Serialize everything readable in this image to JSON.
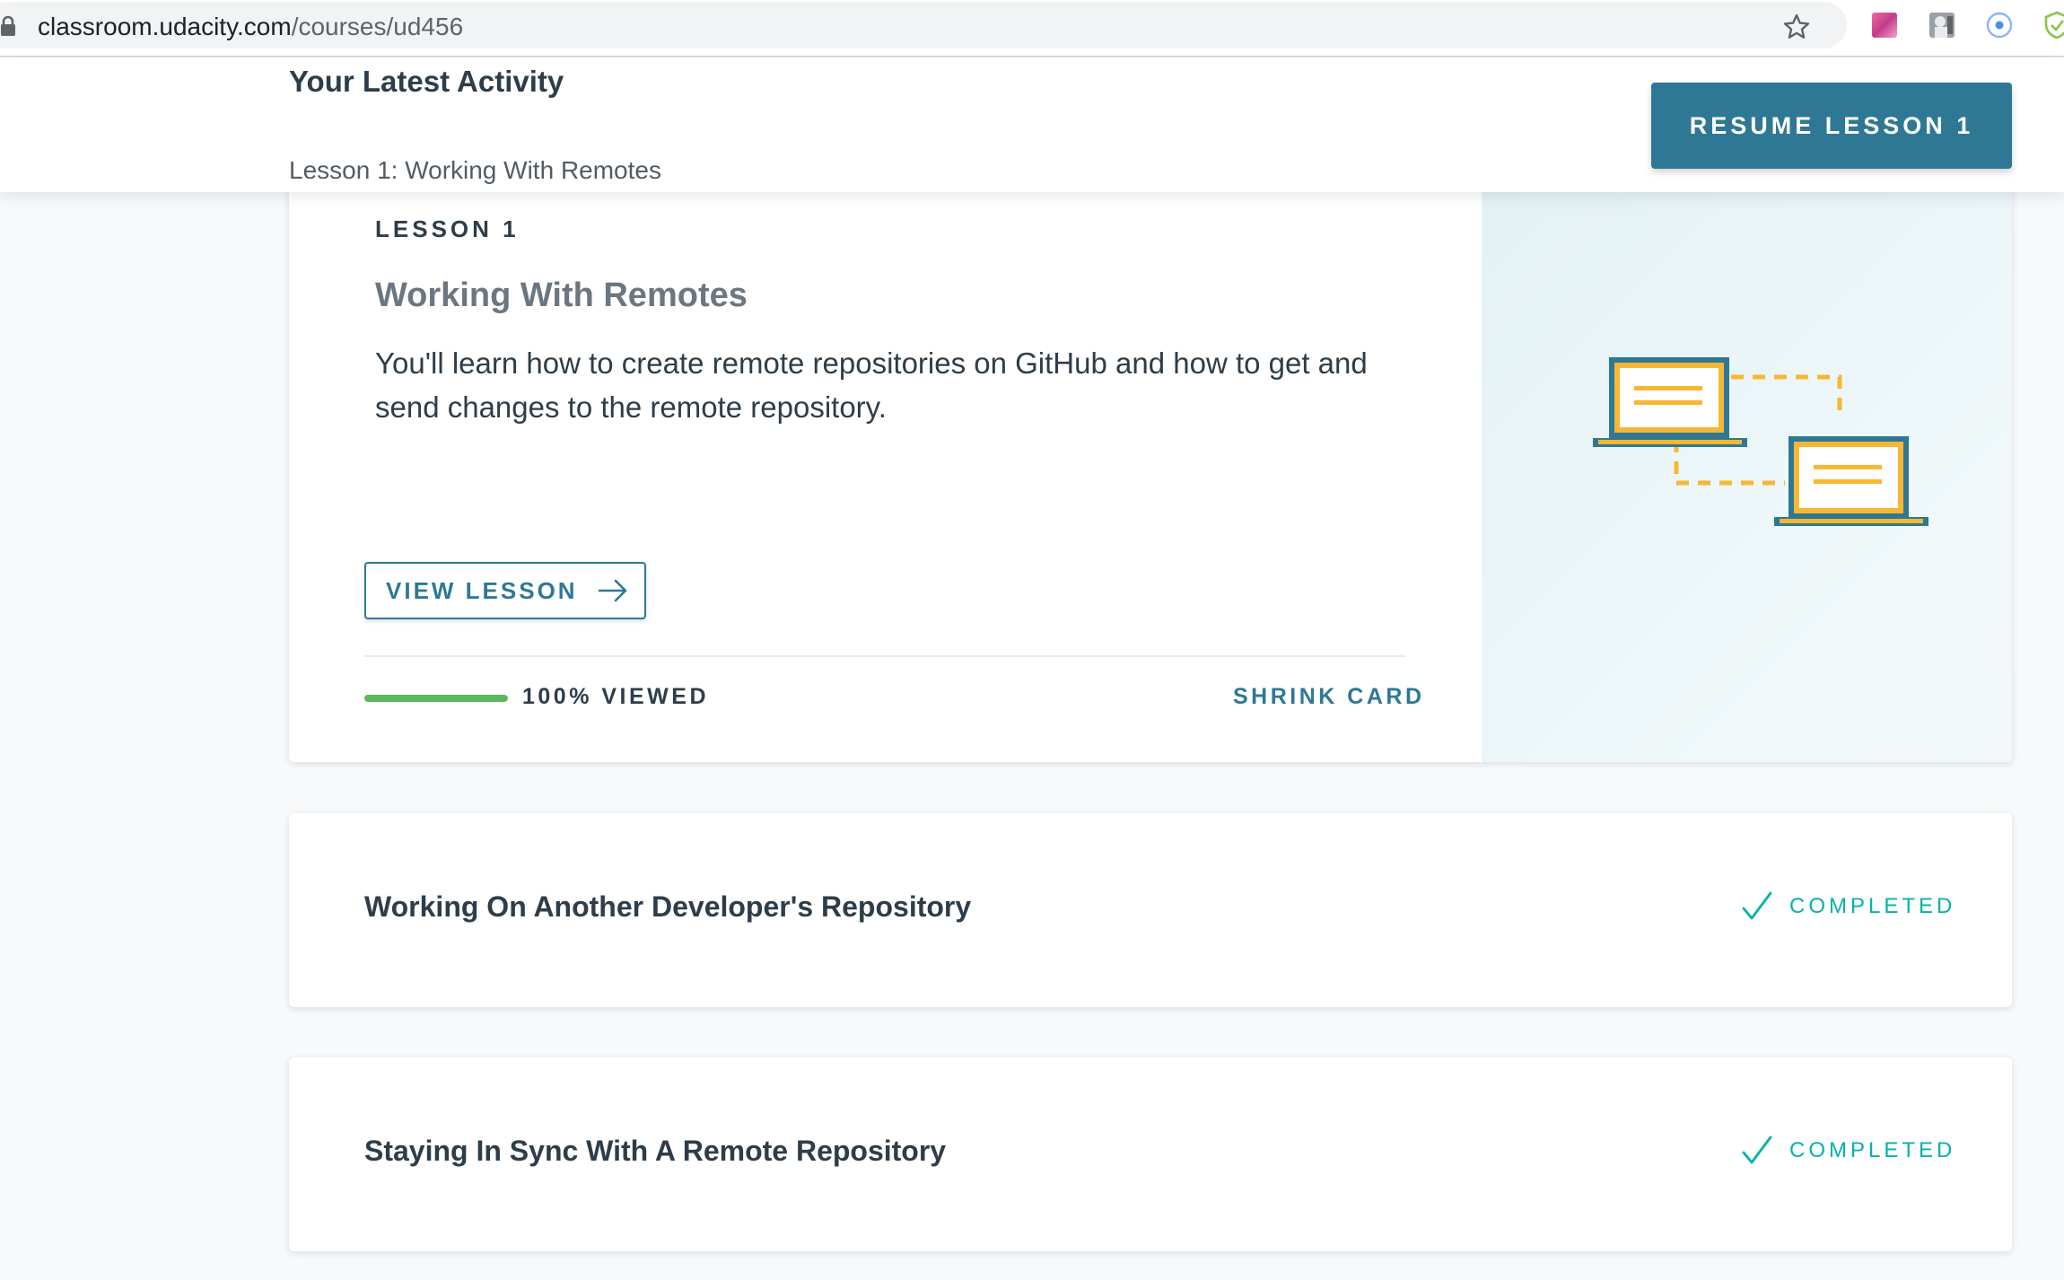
{
  "browser": {
    "url_host": "classroom.udacity.com",
    "url_path": "/courses/ud456",
    "icons": [
      "lock-icon",
      "bookmark-star-icon",
      "extension-gradient-icon",
      "extension-profile-icon",
      "extension-target-icon",
      "extension-shield-icon"
    ]
  },
  "activity_header": {
    "title": "Your Latest Activity",
    "subtitle": "Lesson 1: Working With Remotes",
    "resume_button_label": "RESUME LESSON 1"
  },
  "current_lesson": {
    "number_label": "LESSON 1",
    "title": "Working With Remotes",
    "description": "You'll learn how to create remote repositories on GitHub and how to get and send changes to the remote repository.",
    "view_button_label": "VIEW LESSON",
    "progress_percent": 100,
    "progress_label": "100% VIEWED",
    "shrink_label": "SHRINK CARD",
    "illustration": "two-laptops-connected-icon"
  },
  "lessons": [
    {
      "title": "Working On Another Developer's Repository",
      "status": "COMPLETED"
    },
    {
      "title": "Staying In Sync With A Remote Repository",
      "status": "COMPLETED"
    }
  ],
  "colors": {
    "accent": "#2e7895",
    "progress": "#5cb85c",
    "completed": "#02b3a8",
    "illustration_frame": "#2e7895",
    "illustration_screen": "#f7b733"
  }
}
